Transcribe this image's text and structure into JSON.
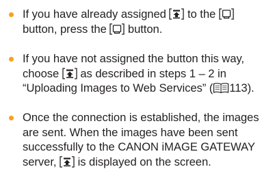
{
  "bullet_color": "#f7a21b",
  "text_color": "#231f20",
  "items": [
    {
      "p1": "If you have already assigned ",
      "p2": " to the ",
      "p3": " button, press the ",
      "p4": " button."
    },
    {
      "p1": "If you have not assigned the button this way, choose ",
      "p2": " as described in steps 1 – 2 in “Uploading Images to Web Services” (",
      "p3": "113)."
    },
    {
      "p1": "Once the connection is established, the images are sent. When the images have been sent successfully to the CANON iMAGE GATEWAY server, ",
      "p2": " is displayed on the screen."
    }
  ],
  "icons": {
    "upload": "upload-to-web-icon",
    "button": "shortcut-button-icon",
    "page_ref": "book-page-reference-icon"
  }
}
